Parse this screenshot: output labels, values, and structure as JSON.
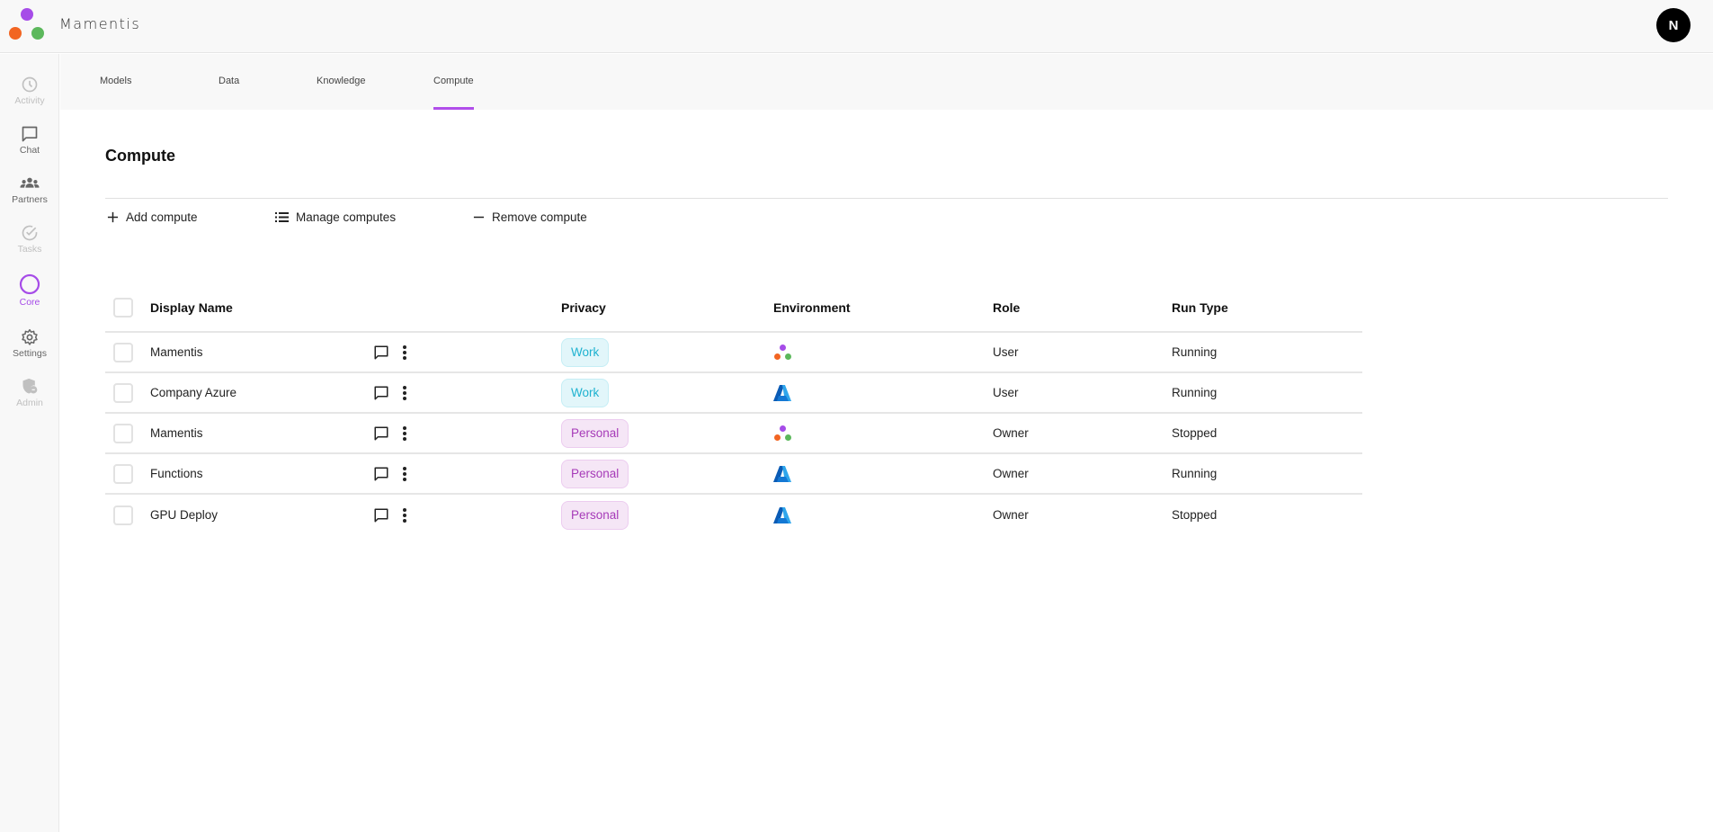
{
  "app": {
    "title": "Mamentis",
    "avatar_initial": "N",
    "brand_colors": {
      "purple": "#a64ce8",
      "orange": "#f26522",
      "green": "#5cb85c"
    }
  },
  "sidebar": {
    "items": [
      {
        "label": "Activity",
        "icon": "clock-icon",
        "state": "disabled"
      },
      {
        "label": "Chat",
        "icon": "chat-icon",
        "state": "normal"
      },
      {
        "label": "Partners",
        "icon": "group-icon",
        "state": "normal"
      },
      {
        "label": "Tasks",
        "icon": "check-circle-icon",
        "state": "disabled"
      },
      {
        "label": "Core",
        "icon": "circle-icon",
        "state": "active"
      },
      {
        "label": "Settings",
        "icon": "gear-icon",
        "state": "normal"
      },
      {
        "label": "Admin",
        "icon": "admin-shield-icon",
        "state": "disabled"
      }
    ]
  },
  "tabs": [
    {
      "label": "Models",
      "selected": false
    },
    {
      "label": "Data",
      "selected": false
    },
    {
      "label": "Knowledge",
      "selected": false
    },
    {
      "label": "Compute",
      "selected": true
    }
  ],
  "page": {
    "title": "Compute",
    "actions": {
      "add": "Add compute",
      "manage": "Manage computes",
      "remove": "Remove compute"
    }
  },
  "table": {
    "columns": {
      "display_name": "Display Name",
      "privacy": "Privacy",
      "environment": "Environment",
      "role": "Role",
      "run_type": "Run Type"
    },
    "rows": [
      {
        "name": "Mamentis",
        "privacy": "Work",
        "environment": "mamentis",
        "role": "User",
        "run_type": "Running"
      },
      {
        "name": "Company Azure",
        "privacy": "Work",
        "environment": "azure",
        "role": "User",
        "run_type": "Running"
      },
      {
        "name": "Mamentis",
        "privacy": "Personal",
        "environment": "mamentis",
        "role": "Owner",
        "run_type": "Stopped"
      },
      {
        "name": "Functions",
        "privacy": "Personal",
        "environment": "azure",
        "role": "Owner",
        "run_type": "Running"
      },
      {
        "name": "GPU Deploy",
        "privacy": "Personal",
        "environment": "azure",
        "role": "Owner",
        "run_type": "Stopped"
      }
    ]
  }
}
